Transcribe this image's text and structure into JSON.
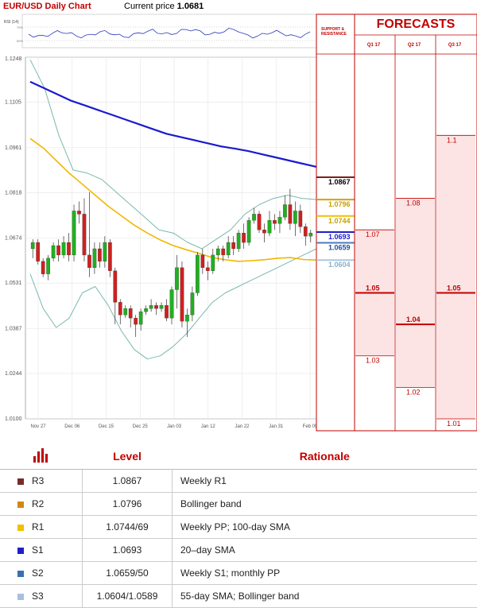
{
  "header": {
    "title": "EUR/USD Daily Chart",
    "price_label": "Current price",
    "price_value": "1.0681"
  },
  "rsi": {
    "label": "RSI (14)",
    "levels": [
      "70%",
      "50%"
    ]
  },
  "chart_data": [
    {
      "type": "candlestick",
      "title": "EUR/USD Daily Chart",
      "ylim": [
        1.01,
        1.1248
      ],
      "y_ticks": [
        "1.1248",
        "1.1105",
        "1.0961",
        "1.0818",
        "1.0674",
        "1.0531",
        "1.0387",
        "1.0244",
        "1.0100"
      ],
      "x_ticks": [
        "Nov 27",
        "Dec 06",
        "Dec 15",
        "Dec 25",
        "Jan 03",
        "Jan 12",
        "Jan 22",
        "Jan 31",
        "Feb 09"
      ],
      "candles": [
        [
          1.064,
          1.066,
          1.061,
          1.067
        ],
        [
          1.066,
          1.06,
          1.059,
          1.067
        ],
        [
          1.06,
          1.056,
          1.055,
          1.061
        ],
        [
          1.056,
          1.061,
          1.054,
          1.062
        ],
        [
          1.061,
          1.065,
          1.06,
          1.066
        ],
        [
          1.065,
          1.062,
          1.06,
          1.067
        ],
        [
          1.062,
          1.066,
          1.061,
          1.068
        ],
        [
          1.066,
          1.062,
          1.06,
          1.069
        ],
        [
          1.062,
          1.076,
          1.06,
          1.078
        ],
        [
          1.076,
          1.075,
          1.072,
          1.079
        ],
        [
          1.075,
          1.062,
          1.06,
          1.08
        ],
        [
          1.062,
          1.058,
          1.055,
          1.082
        ],
        [
          1.058,
          1.064,
          1.056,
          1.066
        ],
        [
          1.064,
          1.06,
          1.058,
          1.066
        ],
        [
          1.06,
          1.066,
          1.058,
          1.068
        ],
        [
          1.066,
          1.057,
          1.055,
          1.067
        ],
        [
          1.057,
          1.047,
          1.04,
          1.058
        ],
        [
          1.047,
          1.043,
          1.04,
          1.048
        ],
        [
          1.043,
          1.045,
          1.042,
          1.046
        ],
        [
          1.045,
          1.042,
          1.039,
          1.046
        ],
        [
          1.042,
          1.04,
          1.036,
          1.043
        ],
        [
          1.04,
          1.044,
          1.038,
          1.045
        ],
        [
          1.044,
          1.045,
          1.043,
          1.046
        ],
        [
          1.045,
          1.046,
          1.044,
          1.048
        ],
        [
          1.046,
          1.045,
          1.043,
          1.047
        ],
        [
          1.045,
          1.046,
          1.044,
          1.047
        ],
        [
          1.046,
          1.042,
          1.041,
          1.048
        ],
        [
          1.042,
          1.051,
          1.04,
          1.052
        ],
        [
          1.051,
          1.058,
          1.045,
          1.062
        ],
        [
          1.058,
          1.041,
          1.039,
          1.06
        ],
        [
          1.041,
          1.043,
          1.036,
          1.045
        ],
        [
          1.043,
          1.05,
          1.041,
          1.052
        ],
        [
          1.05,
          1.062,
          1.049,
          1.063
        ],
        [
          1.062,
          1.058,
          1.056,
          1.064
        ],
        [
          1.058,
          1.057,
          1.054,
          1.06
        ],
        [
          1.057,
          1.062,
          1.056,
          1.064
        ],
        [
          1.062,
          1.064,
          1.06,
          1.065
        ],
        [
          1.064,
          1.062,
          1.06,
          1.065
        ],
        [
          1.062,
          1.066,
          1.061,
          1.068
        ],
        [
          1.066,
          1.064,
          1.062,
          1.068
        ],
        [
          1.064,
          1.069,
          1.063,
          1.07
        ],
        [
          1.069,
          1.066,
          1.064,
          1.072
        ],
        [
          1.066,
          1.073,
          1.065,
          1.074
        ],
        [
          1.073,
          1.075,
          1.072,
          1.077
        ],
        [
          1.075,
          1.07,
          1.069,
          1.076
        ],
        [
          1.07,
          1.069,
          1.066,
          1.072
        ],
        [
          1.069,
          1.073,
          1.068,
          1.076
        ],
        [
          1.073,
          1.072,
          1.07,
          1.075
        ],
        [
          1.072,
          1.074,
          1.069,
          1.076
        ],
        [
          1.074,
          1.078,
          1.073,
          1.081
        ],
        [
          1.078,
          1.072,
          1.07,
          1.083
        ],
        [
          1.072,
          1.076,
          1.068,
          1.079
        ],
        [
          1.076,
          1.071,
          1.069,
          1.078
        ],
        [
          1.071,
          1.068,
          1.065,
          1.072
        ],
        [
          1.068,
          1.069,
          1.066,
          1.07
        ]
      ],
      "sma_200": [
        1.117,
        1.115,
        1.113,
        1.111,
        1.1095,
        1.108,
        1.1065,
        1.105,
        1.1035,
        1.102,
        1.1005,
        1.0995,
        1.0985,
        1.0975,
        1.0965,
        1.0958,
        1.095,
        1.094,
        1.093,
        1.092,
        1.091,
        1.09
      ],
      "sma_55": [
        1.099,
        1.096,
        1.092,
        1.088,
        1.0845,
        1.081,
        1.0775,
        1.0745,
        1.0715,
        1.069,
        1.0668,
        1.065,
        1.0637,
        1.0625,
        1.0612,
        1.0605,
        1.06,
        1.0602,
        1.0605,
        1.061,
        1.0612,
        1.0606,
        1.0604
      ],
      "bb_upper": [
        1.124,
        1.115,
        1.1,
        1.089,
        1.088,
        1.086,
        1.082,
        1.078,
        1.074,
        1.07,
        1.069,
        1.066,
        1.064,
        1.067,
        1.07,
        1.075,
        1.078,
        1.08,
        1.081,
        1.08,
        1.0796
      ],
      "bb_lower": [
        1.056,
        1.045,
        1.039,
        1.042,
        1.05,
        1.052,
        1.046,
        1.038,
        1.032,
        1.029,
        1.03,
        1.033,
        1.037,
        1.042,
        1.047,
        1.05,
        1.052,
        1.054,
        1.056,
        1.058,
        1.06,
        1.062,
        1.064
      ]
    },
    {
      "type": "table",
      "title": "FORECASTS",
      "columns": [
        "Q1 17",
        "Q2 17",
        "Q3 17"
      ],
      "values": [
        [
          1.07,
          1.05,
          1.03
        ],
        [
          1.08,
          1.04,
          1.02
        ],
        [
          1.1,
          1.05,
          1.01
        ]
      ],
      "labels": [
        [
          "1.07",
          "1.05",
          "1.03"
        ],
        [
          "1.08",
          "1.04",
          "1.02"
        ],
        [
          "1.1",
          "1.05",
          "1.01"
        ]
      ]
    }
  ],
  "support_resistance": {
    "title": "SUPPORT & RESISTANCE",
    "levels": [
      {
        "label": "1.0867",
        "value": 1.0867,
        "color": "#7b1f1f",
        "fg": "#000000",
        "bold": true
      },
      {
        "label": "1.0796",
        "value": 1.0796,
        "color": "#d8a000",
        "fg": "#c8a000",
        "bold": true
      },
      {
        "label": "1.0744",
        "value": 1.0744,
        "color": "#f0c000",
        "fg": "#c8a000",
        "bold": true
      },
      {
        "label": "1.0693",
        "value": 1.0693,
        "color": "#1f1fc8",
        "fg": "#1f1fc8",
        "bold": true
      },
      {
        "label": "1.0659",
        "value": 1.0659,
        "color": "#4a7bbf",
        "fg": "#1f4fa0",
        "bold": true
      },
      {
        "label": "1.0604",
        "value": 1.0604,
        "color": "#a8c8e0",
        "fg": "#8ab0c8",
        "bold": true
      }
    ]
  },
  "table": {
    "headers": [
      "Level",
      "Rationale"
    ],
    "rows": [
      {
        "name": "R3",
        "level": "1.0867",
        "rationale": "Weekly R1",
        "color": "#7b2a2a"
      },
      {
        "name": "R2",
        "level": "1.0796",
        "rationale": "Bollinger band",
        "color": "#d08a10"
      },
      {
        "name": "R1",
        "level": "1.0744/69",
        "rationale": "Weekly PP; 100-day SMA",
        "color": "#f0c000"
      },
      {
        "name": "S1",
        "level": "1.0693",
        "rationale": "20–day SMA",
        "color": "#1f1fc8"
      },
      {
        "name": "S2",
        "level": "1.0659/50",
        "rationale": "Weekly S1; monthly PP",
        "color": "#3b6fb0"
      },
      {
        "name": "S3",
        "level": "1.0604/1.0589",
        "rationale": "55-day SMA; Bollinger band",
        "color": "#a8c0dc"
      }
    ]
  }
}
